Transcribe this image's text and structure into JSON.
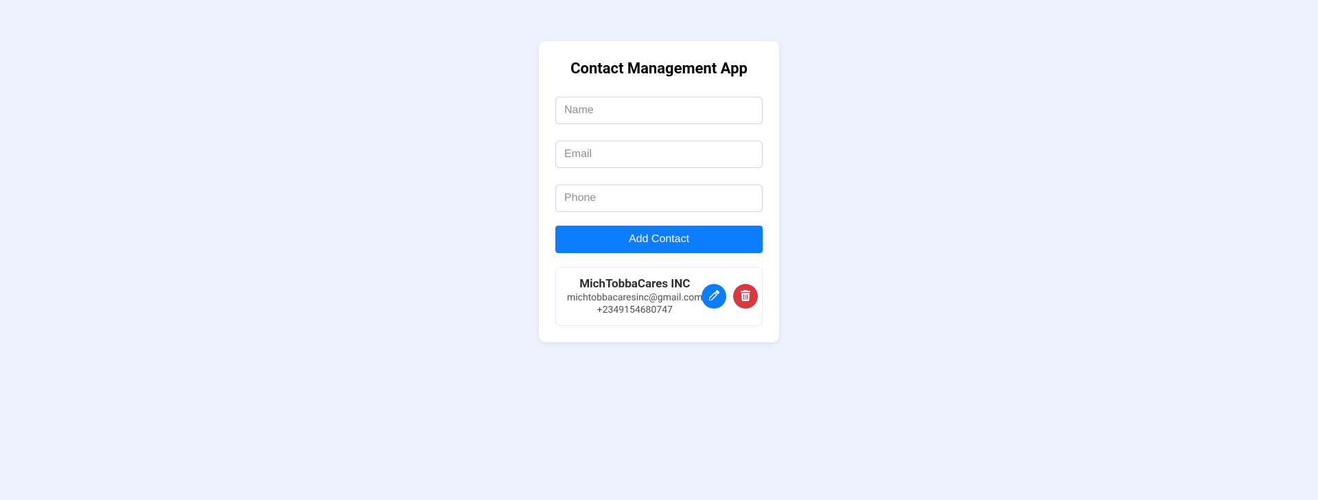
{
  "app": {
    "title": "Contact Management App"
  },
  "form": {
    "name_placeholder": "Name",
    "email_placeholder": "Email",
    "phone_placeholder": "Phone",
    "add_button_label": "Add Contact"
  },
  "contacts": [
    {
      "name": "MichTobbaCares INC",
      "email": "michtobbacaresinc@gmail.com",
      "phone": "+2349154680747"
    }
  ]
}
